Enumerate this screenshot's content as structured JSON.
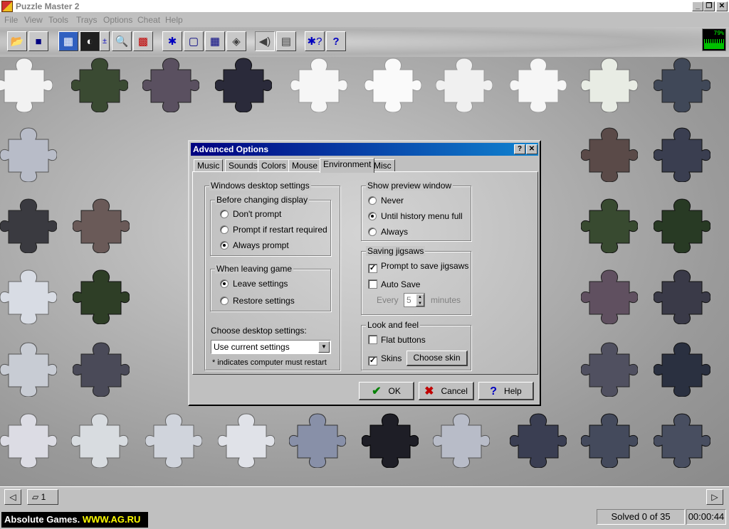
{
  "window": {
    "title": "Puzzle Master 2",
    "controls": {
      "minimize": "_",
      "maximize": "❐",
      "close": "✕"
    }
  },
  "menu": [
    "File",
    "View",
    "Tools",
    "Trays",
    "Options",
    "Cheat",
    "Help"
  ],
  "toolbar": {
    "icons": [
      "folder-open-icon",
      "save-icon",
      "image-icon",
      "preview-icon",
      "zoom-level-icon",
      "magnify-icon",
      "palette-icon",
      "piece-icon",
      "border-icon",
      "grid-icon",
      "scatter-icon",
      "sound-icon",
      "tray-icon",
      "puzzle-help-icon",
      "help-icon"
    ],
    "cpu_readout": "79%"
  },
  "dialog": {
    "title": "Advanced Options",
    "help_glyph": "?",
    "close_glyph": "✕",
    "tabs": [
      "Music",
      "Sounds",
      "Colors",
      "Mouse",
      "Environment",
      "Misc"
    ],
    "active_tab": "Environment",
    "desktop": {
      "group_label": "Windows desktop settings",
      "before_label": "Before changing display",
      "before_options": [
        "Don't prompt",
        "Prompt if restart required",
        "Always prompt"
      ],
      "before_selected": 2,
      "leaving_label": "When leaving game",
      "leaving_options": [
        "Leave settings",
        "Restore settings"
      ],
      "leaving_selected": 0,
      "choose_label": "Choose desktop settings:",
      "choose_value": "Use current settings",
      "footnote": "* indicates computer must restart"
    },
    "preview": {
      "group_label": "Show preview window",
      "options": [
        "Never",
        "Until history menu full",
        "Always"
      ],
      "selected": 1
    },
    "saving": {
      "group_label": "Saving jigsaws",
      "prompt_label": "Prompt to save jigsaws",
      "prompt_checked": true,
      "autosave_label": "Auto Save",
      "autosave_checked": false,
      "every_label": "Every",
      "every_value": "5",
      "minutes_label": "minutes"
    },
    "look": {
      "group_label": "Look and feel",
      "flat_label": "Flat buttons",
      "flat_checked": false,
      "skins_label": "Skins",
      "skins_checked": true,
      "choose_skin": "Choose skin"
    },
    "buttons": {
      "ok": "OK",
      "cancel": "Cancel",
      "help": "Help"
    }
  },
  "tray": {
    "count": "1"
  },
  "status": {
    "brand_name": "Absolute Games.",
    "brand_url": "WWW.AG.RU",
    "solved": "Solved 0 of 35",
    "time": "00:00:44"
  },
  "colors": {
    "dialog_title_start": "#000080",
    "dialog_title_end": "#1084d0",
    "ok_check": "#008000",
    "cancel_x": "#c00000",
    "help_q": "#0000c0",
    "brand_url": "#ffff00"
  }
}
